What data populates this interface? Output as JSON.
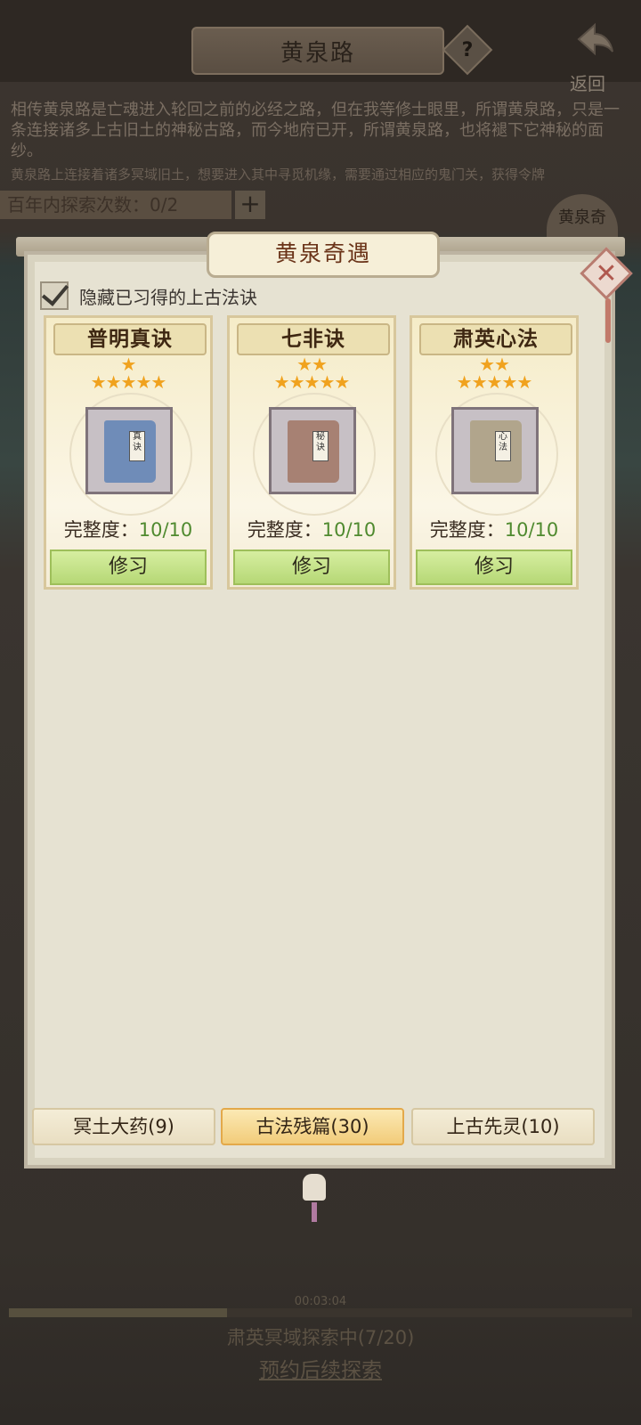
{
  "header": {
    "title": "黄泉路",
    "help_label": "?",
    "back_label": "返回"
  },
  "intro": {
    "line1": "相传黄泉路是亡魂进入轮回之前的必经之路，但在我等修士眼里，所谓黄泉路，只是一条连接诸多上古旧土的神秘古路，而今地府已开，所谓黄泉路，也将褪下它神秘的面纱。",
    "line2": "黄泉路上连接着诸多冥域旧土，想要进入其中寻觅机缘，需要通过相应的鬼门关，获得令牌"
  },
  "explore": {
    "count_text": "百年内探索次数：0/2",
    "plus_label": "+",
    "side_tag": "黄泉奇"
  },
  "modal": {
    "title": "黄泉奇遇",
    "close_label": "✕",
    "hide_checkbox_checked": true,
    "hide_label": "隐藏已习得的上古法诀"
  },
  "cards": [
    {
      "name": "普明真诀",
      "stars_top": "★",
      "stars_bottom": "★★★★★",
      "completeness_label": "完整度：",
      "completeness_value": "10/10",
      "learn_label": "修习",
      "book_color": "#6f8cb8",
      "book_tag": "真诀"
    },
    {
      "name": "七非诀",
      "stars_top": "★★",
      "stars_bottom": "★★★★★",
      "completeness_label": "完整度：",
      "completeness_value": "10/10",
      "learn_label": "修习",
      "book_color": "#a78173",
      "book_tag": "秘诀"
    },
    {
      "name": "肃英心法",
      "stars_top": "★★",
      "stars_bottom": "★★★★★",
      "completeness_label": "完整度：",
      "completeness_value": "10/10",
      "learn_label": "修习",
      "book_color": "#b1a58c",
      "book_tag": "心法"
    }
  ],
  "tabs": [
    {
      "label": "冥土大药(9)",
      "active": false
    },
    {
      "label": "古法残篇(30)",
      "active": true
    },
    {
      "label": "上古先灵(10)",
      "active": false
    }
  ],
  "footer": {
    "timer": "00:03:04",
    "progress_fraction": 0.35,
    "status": "肃英冥域探索中(7/20)",
    "reserve_link": "预约后续探索"
  }
}
